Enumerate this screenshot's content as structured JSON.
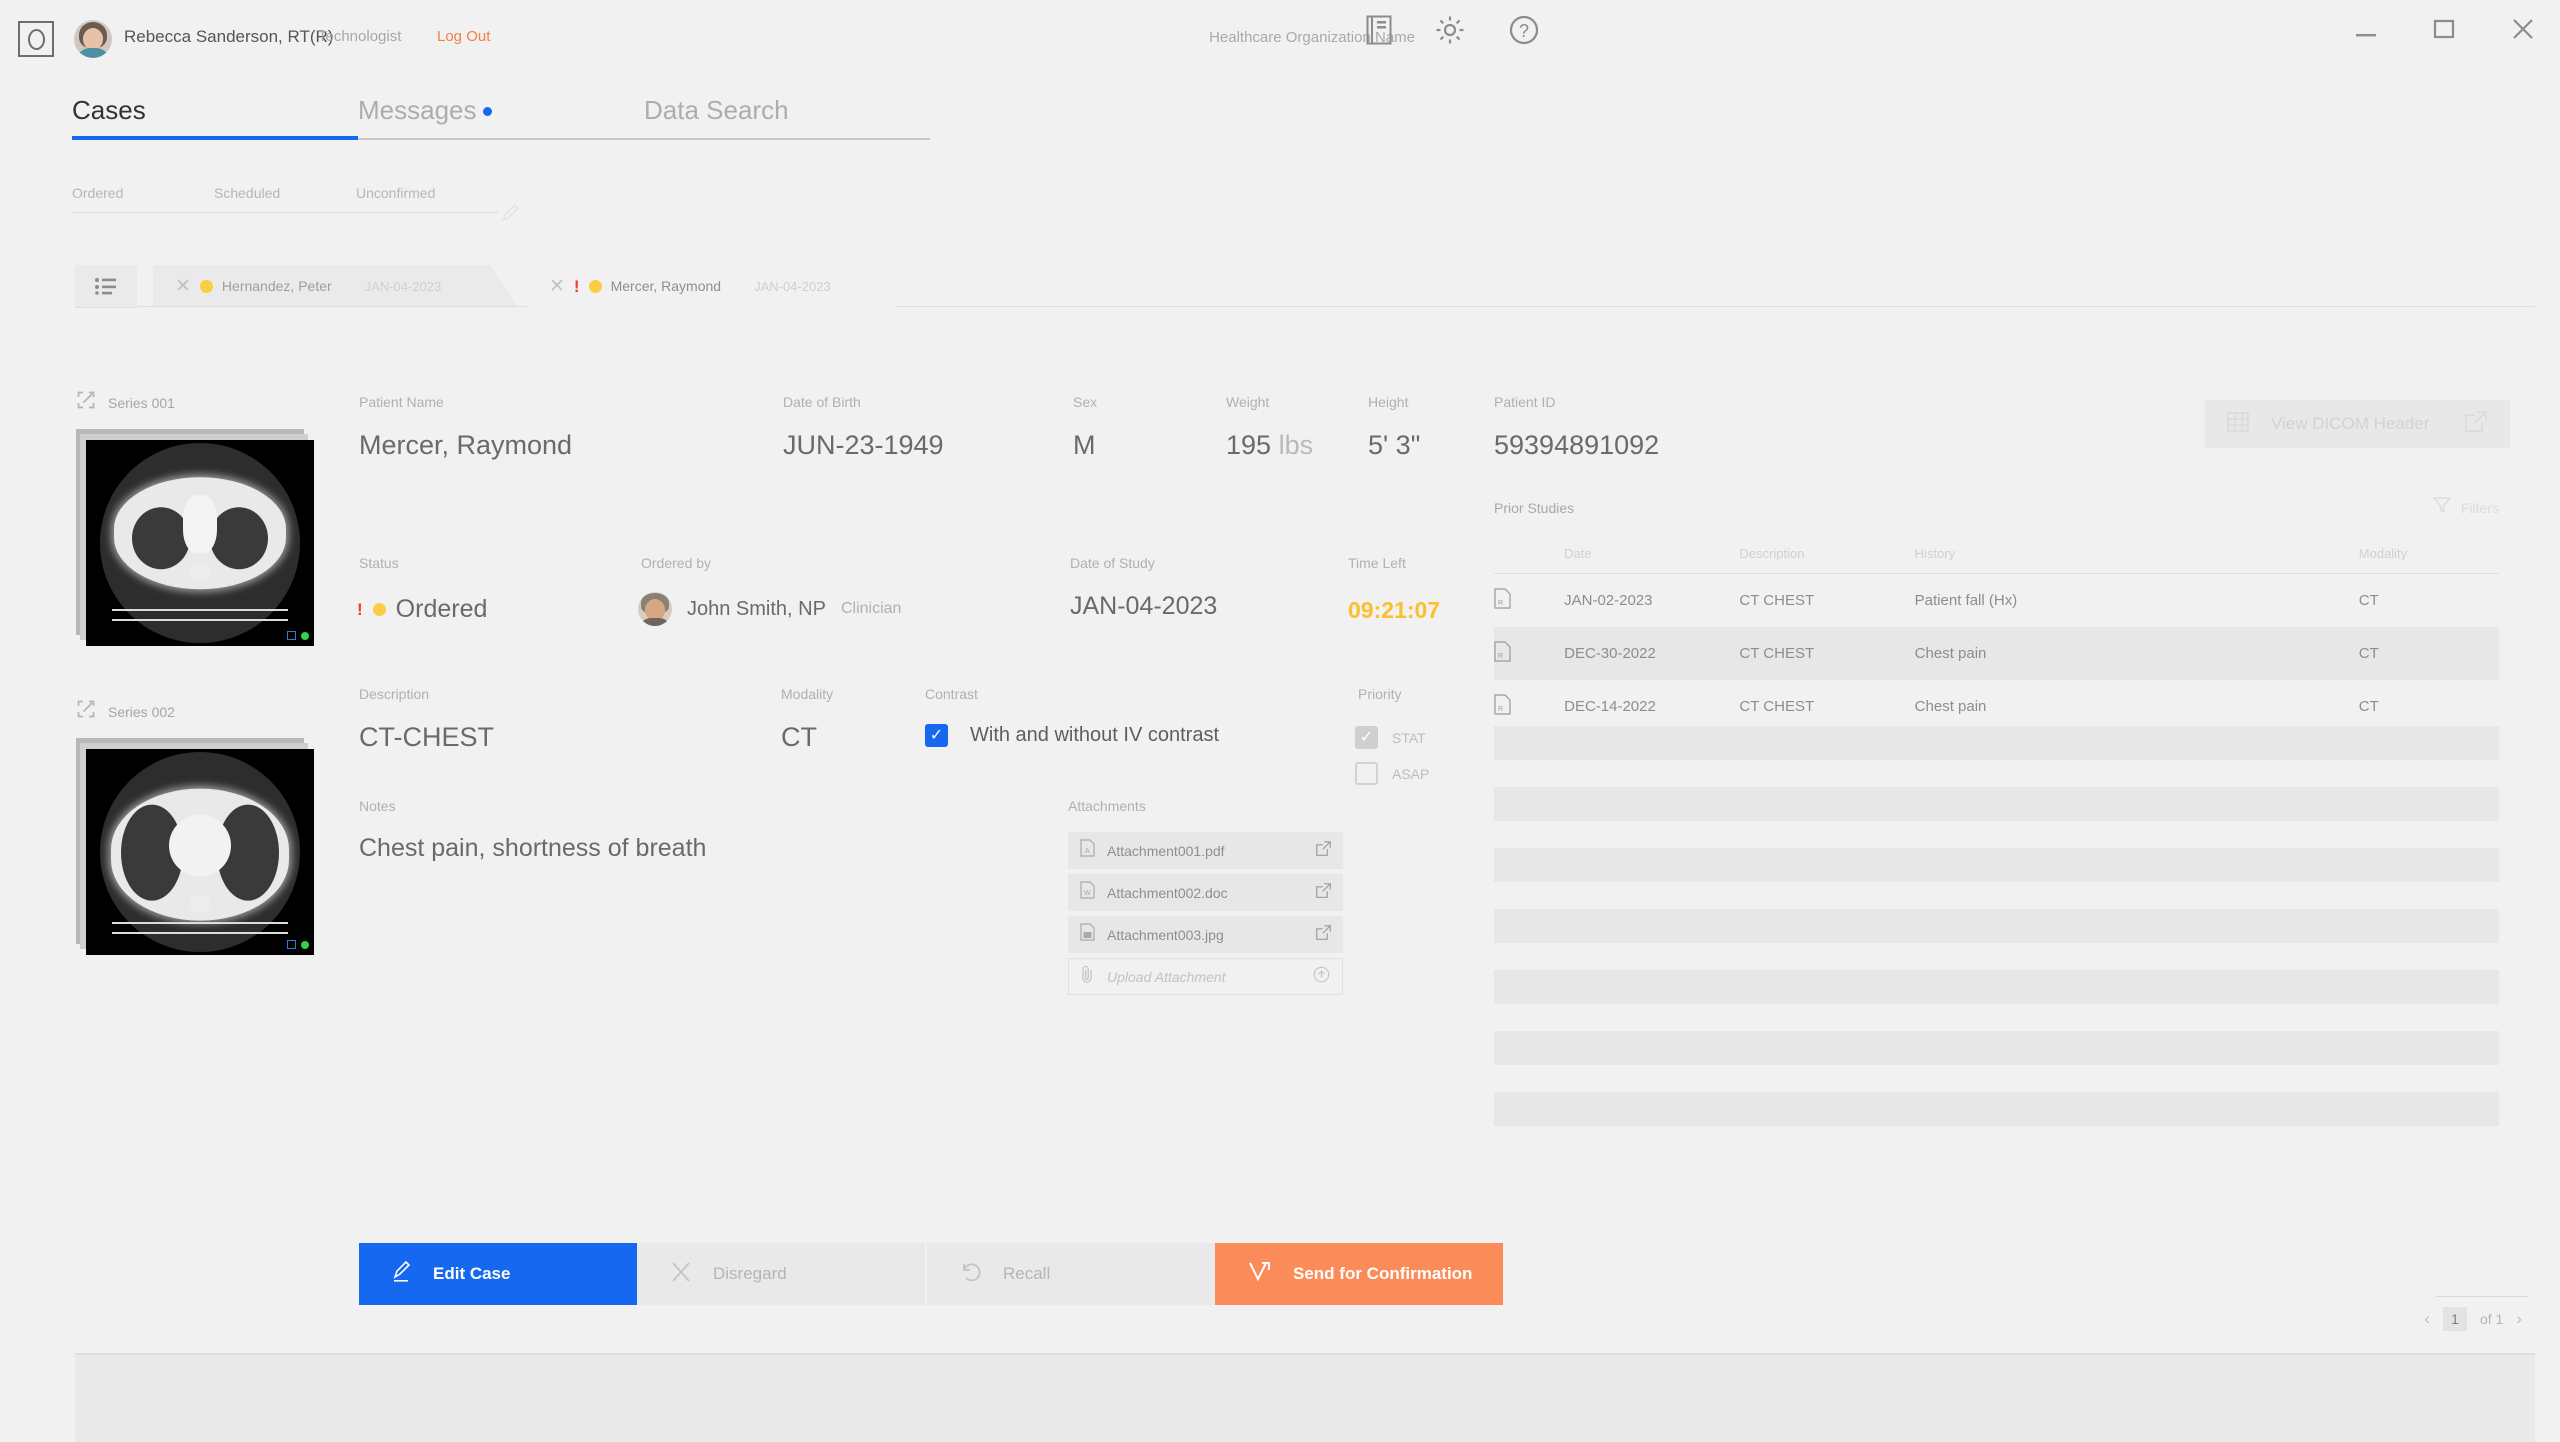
{
  "titlebar": {
    "logo_icon": "app-logo-icon",
    "user_name": "Rebecca Sanderson, RT(R)",
    "user_role": "Technologist",
    "logout_label": "Log Out",
    "org_name": "Healthcare Organization Name",
    "icons": [
      "document-icon",
      "gear-icon",
      "help-icon"
    ],
    "window_controls": [
      "minimize-icon",
      "maximize-icon",
      "close-icon"
    ]
  },
  "main_tabs": [
    {
      "label": "Cases",
      "active": true,
      "badge": false
    },
    {
      "label": "Messages",
      "active": false,
      "badge": true
    },
    {
      "label": "Data Search",
      "active": false,
      "badge": false
    }
  ],
  "sub_tabs": [
    {
      "label": "Ordered"
    },
    {
      "label": "Scheduled"
    },
    {
      "label": "Unconfirmed"
    }
  ],
  "case_tabs": [
    {
      "name": "Hernandez, Peter",
      "date": "JAN-04-2023",
      "urgent": false,
      "status_color": "#fccd44",
      "active": false
    },
    {
      "name": "Mercer, Raymond",
      "date": "JAN-04-2023",
      "urgent": true,
      "status_color": "#fccd44",
      "active": true
    }
  ],
  "series": [
    {
      "label": "Series 001"
    },
    {
      "label": "Series 002"
    }
  ],
  "patient": {
    "name_label": "Patient Name",
    "name_value": "Mercer, Raymond",
    "dob_label": "Date of Birth",
    "dob_value": "JUN-23-1949",
    "sex_label": "Sex",
    "sex_value": "M",
    "weight_label": "Weight",
    "weight_value": "195",
    "weight_unit": "lbs",
    "height_label": "Height",
    "height_value": "5' 3\"",
    "id_label": "Patient ID",
    "id_value": "59394891092"
  },
  "dicom_button": {
    "label": "View DICOM Header",
    "icon": "table-icon",
    "open_icon": "external-link-icon"
  },
  "order": {
    "status_label": "Status",
    "status_value": "Ordered",
    "status_urgent": true,
    "ordered_by_label": "Ordered by",
    "ordered_by_name": "John Smith, NP",
    "ordered_by_role": "Clinician",
    "date_of_study_label": "Date of Study",
    "date_of_study_value": "JAN-04-2023",
    "time_left_label": "Time Left",
    "time_left_value": "09:21:07",
    "time_left_color": "#fbc02d"
  },
  "exam": {
    "description_label": "Description",
    "description_value": "CT-CHEST",
    "modality_label": "Modality",
    "modality_value": "CT",
    "contrast_label": "Contrast",
    "contrast_value": "With and without IV contrast",
    "contrast_checked": true,
    "priority_label": "Priority",
    "priority_options": [
      {
        "label": "STAT",
        "checked": true,
        "disabled": true
      },
      {
        "label": "ASAP",
        "checked": false,
        "disabled": true
      }
    ]
  },
  "notes": {
    "label": "Notes",
    "value": "Chest pain, shortness of breath"
  },
  "attachments": {
    "label": "Attachments",
    "items": [
      {
        "name": "Attachment001.pdf",
        "type": "pdf"
      },
      {
        "name": "Attachment002.doc",
        "type": "doc"
      },
      {
        "name": "Attachment003.jpg",
        "type": "jpg"
      }
    ],
    "upload_placeholder": "Upload Attachment"
  },
  "prior_studies": {
    "title": "Prior Studies",
    "filters_label": "Filters",
    "columns": [
      "",
      "Date",
      "Description",
      "History",
      "Modality"
    ],
    "rows": [
      {
        "date": "JAN-02-2023",
        "description": "CT CHEST",
        "history": "Patient fall (Hx)",
        "modality": "CT"
      },
      {
        "date": "DEC-30-2022",
        "description": "CT CHEST",
        "history": "Chest pain",
        "modality": "CT"
      },
      {
        "date": "DEC-14-2022",
        "description": "CT CHEST",
        "history": "Chest pain",
        "modality": "CT"
      }
    ],
    "placeholder_row_count": 7
  },
  "actions": [
    {
      "label": "Edit Case",
      "icon": "pencil-icon",
      "style": "primary"
    },
    {
      "label": "Disregard",
      "icon": "x-icon",
      "style": "ghost"
    },
    {
      "label": "Recall",
      "icon": "undo-icon",
      "style": "ghost"
    },
    {
      "label": "Send for Confirmation",
      "icon": "send-icon",
      "style": "accent"
    }
  ],
  "pagination": {
    "prev": "‹",
    "page": "1",
    "of_label": "of 1",
    "next": "›"
  },
  "colors": {
    "accent_blue": "#1668f0",
    "accent_orange": "#fb8c5a",
    "logout_orange": "#f47e48",
    "amber": "#fccd44",
    "alert_red": "#f03b2e",
    "background": "#f1f1f1"
  }
}
